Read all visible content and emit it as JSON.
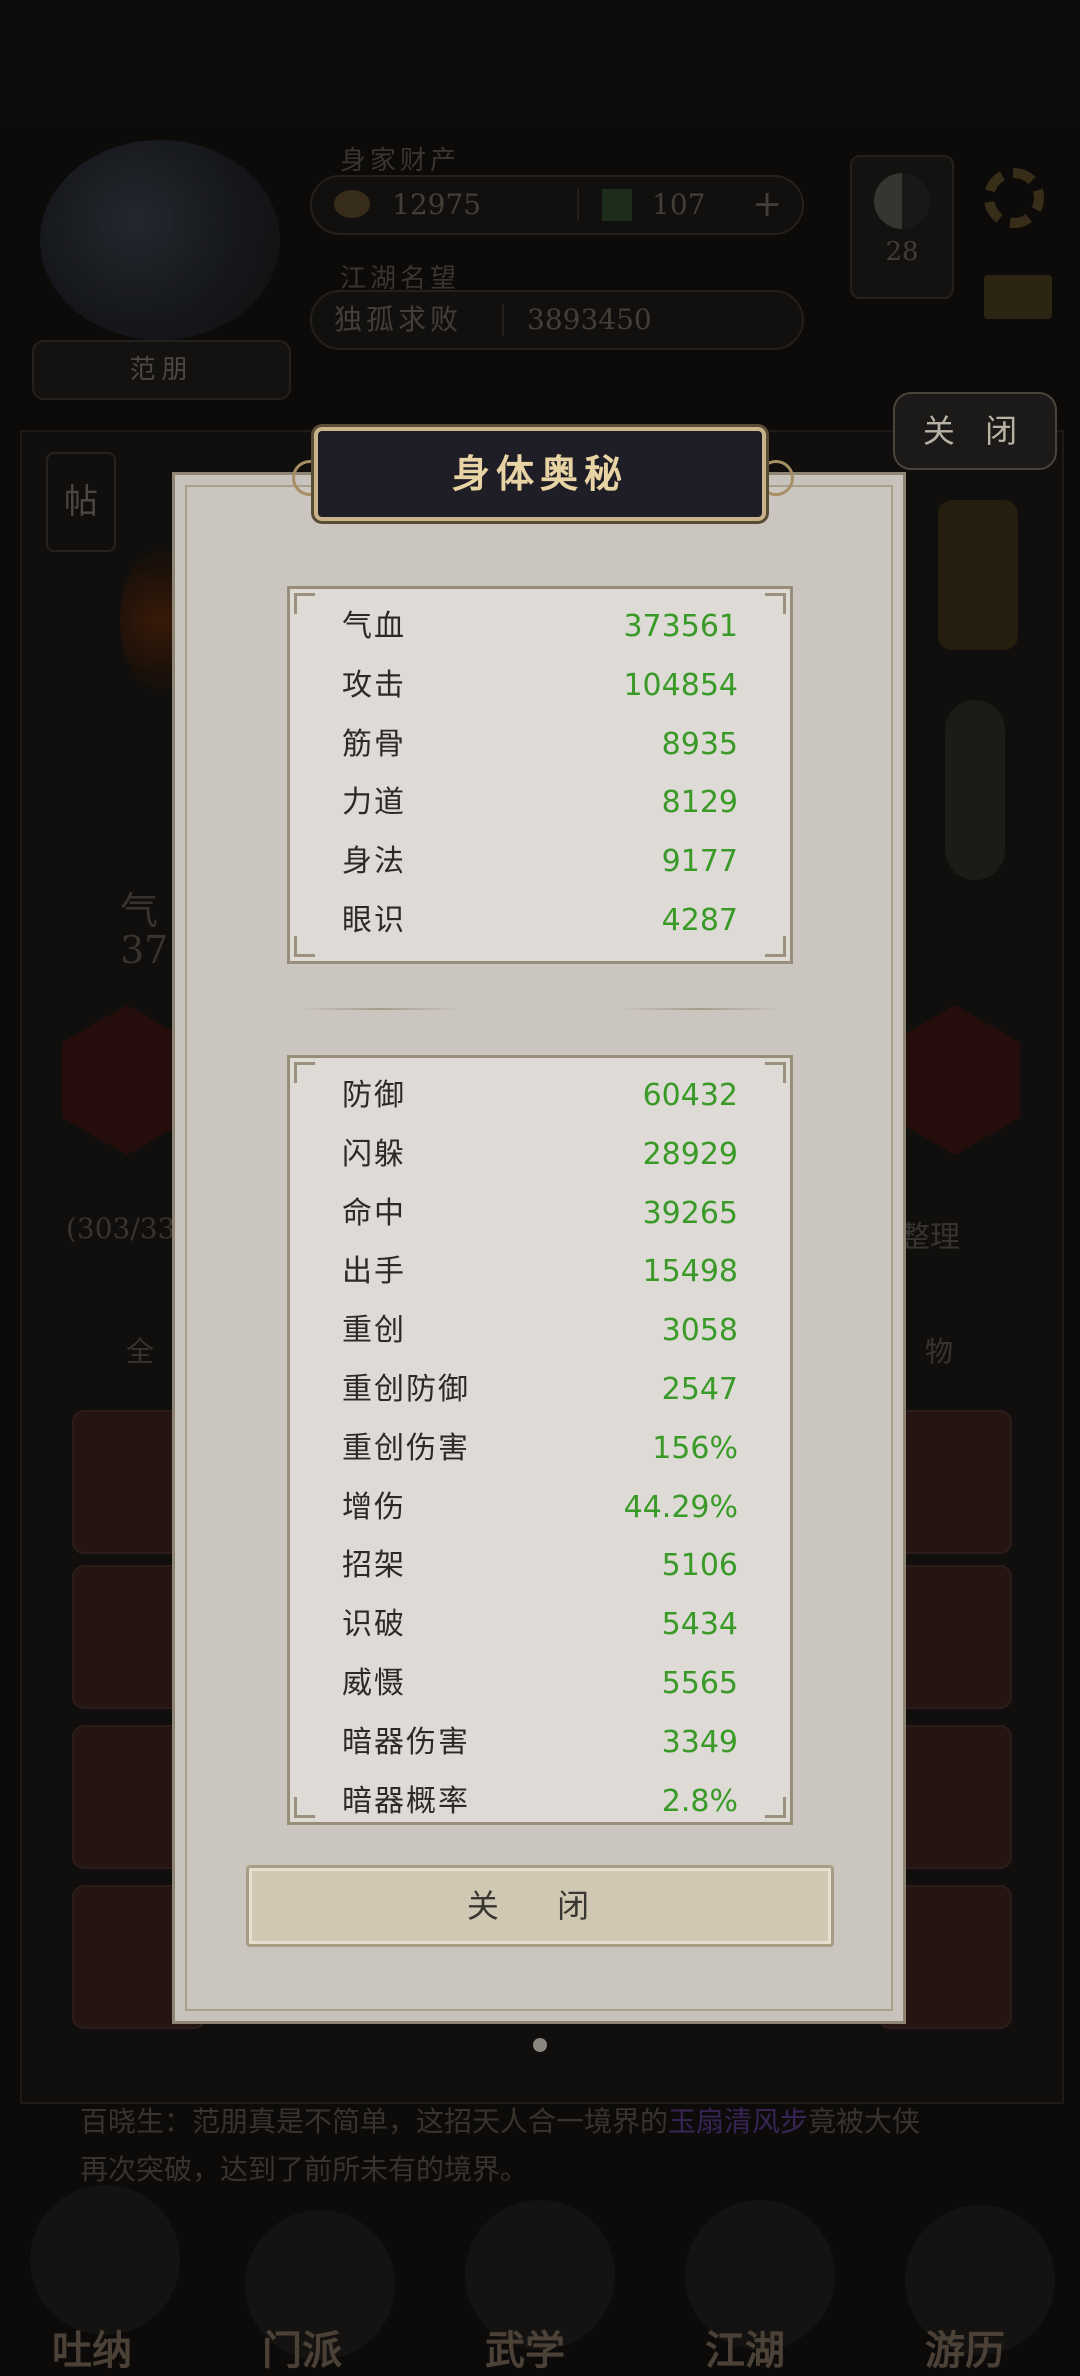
{
  "header": {
    "assets_label": "身家财产",
    "currency1": "12975",
    "currency2": "107",
    "plus": "+",
    "reputation_label": "江湖名望",
    "reputation_title": "独孤求败",
    "reputation_value": "3893450",
    "taichi_value": "28",
    "player_name": "范朋"
  },
  "background": {
    "close_label": "关 闭",
    "side_tag": "帖",
    "left_stat_label": "气",
    "left_stat_value": "37",
    "inventory_count": "(303/33",
    "sort_button": "整理",
    "tab_all": "全",
    "tab_item": "物",
    "story_line1": "百晓生：范朋真是不简单，这招天人合一境界的",
    "story_highlight": "玉扇清风步",
    "story_line1b": "竟被大侠",
    "story_line2": "再次突破，达到了前所未有的境界。",
    "nav": [
      "吐纳",
      "门派",
      "武学",
      "江湖",
      "游历"
    ]
  },
  "modal": {
    "title": "身体奥秘",
    "close_label": "关 闭",
    "base_stats": [
      {
        "name": "气血",
        "value": "373561"
      },
      {
        "name": "攻击",
        "value": "104854"
      },
      {
        "name": "筋骨",
        "value": "8935"
      },
      {
        "name": "力道",
        "value": "8129"
      },
      {
        "name": "身法",
        "value": "9177"
      },
      {
        "name": "眼识",
        "value": "4287"
      }
    ],
    "adv_stats": [
      {
        "name": "防御",
        "value": "60432"
      },
      {
        "name": "闪躲",
        "value": "28929"
      },
      {
        "name": "命中",
        "value": "39265"
      },
      {
        "name": "出手",
        "value": "15498"
      },
      {
        "name": "重创",
        "value": "3058"
      },
      {
        "name": "重创防御",
        "value": "2547"
      },
      {
        "name": "重创伤害",
        "value": "156%"
      },
      {
        "name": "增伤",
        "value": "44.29%"
      },
      {
        "name": "招架",
        "value": "5106"
      },
      {
        "name": "识破",
        "value": "5434"
      },
      {
        "name": "威慑",
        "value": "5565"
      },
      {
        "name": "暗器伤害",
        "value": "3349"
      },
      {
        "name": "暗器概率",
        "value": "2.8%"
      }
    ]
  },
  "colors": {
    "stat_value": "#3a9a28",
    "title_text": "#e7d3a3",
    "modal_bg": "#cbc5c0"
  }
}
